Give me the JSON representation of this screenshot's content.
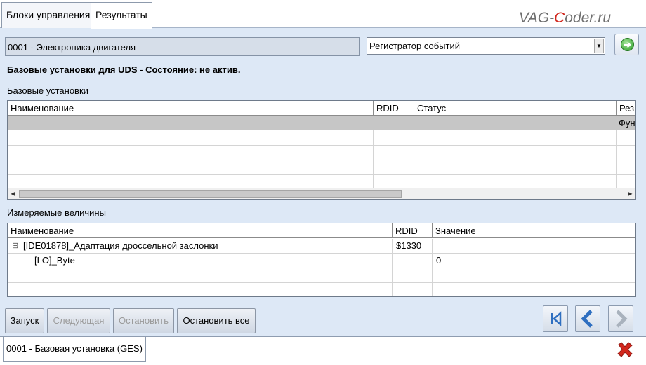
{
  "tabs": [
    {
      "label": "Блоки управления",
      "active": false
    },
    {
      "label": "Результаты",
      "active": true
    }
  ],
  "watermark": {
    "pre": "VAG-",
    "accent": "C",
    "post": "oder.ru"
  },
  "module": {
    "value": "0001 - Электроника двигателя"
  },
  "mode_select": {
    "value": "Регистратор событий"
  },
  "go_button": {
    "icon": "arrow-right-icon"
  },
  "status_title": "Базовые установки для UDS - Состояние: не актив.",
  "basic_settings": {
    "label": "Базовые установки",
    "columns": [
      "Наименование",
      "RDID",
      "Статус",
      "Рез"
    ],
    "selected_row_text": "Фун"
  },
  "measured": {
    "label": "Измеряемые величины",
    "columns": [
      "Наименование",
      "RDID",
      "Значение"
    ],
    "rows": [
      {
        "name": "[IDE01878]_Адаптация дроссельной заслонки",
        "rdid": "$1330",
        "value": "",
        "expander": "⊟"
      },
      {
        "name": "[LO]_Byte",
        "rdid": "",
        "value": "0"
      }
    ]
  },
  "buttons": {
    "start": "Запуск",
    "next": "Следующая",
    "stop": "Остановить",
    "stop_all": "Остановить все"
  },
  "bottom_tab": "0001 - Базовая установка (GES)",
  "colors": {
    "background": "#dde8f6",
    "nav_blue": "#2f6fc0",
    "close_red": "#d2281e",
    "go_green": "#2e9c2b"
  }
}
